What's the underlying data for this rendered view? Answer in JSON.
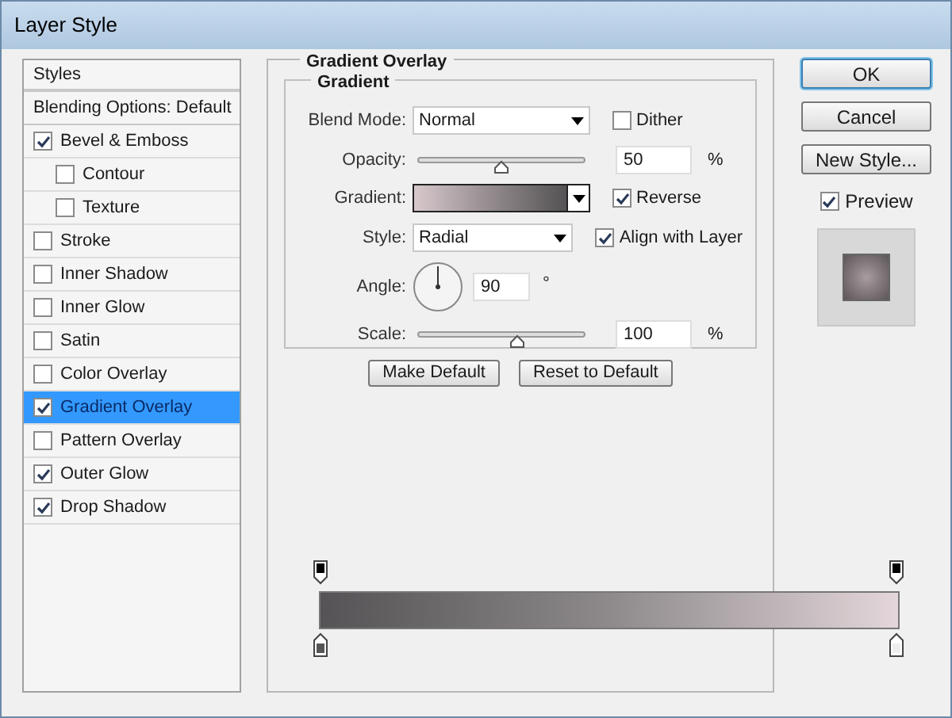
{
  "window": {
    "title": "Layer Style"
  },
  "sidebar": {
    "items": [
      {
        "label": "Styles",
        "kind": "header",
        "selected": false
      },
      {
        "label": "Blending Options: Default",
        "kind": "plain",
        "selected": false
      },
      {
        "label": "Bevel & Emboss",
        "kind": "check",
        "checked": true,
        "selected": false,
        "children": [
          {
            "label": "Contour",
            "kind": "check",
            "checked": false,
            "selected": false
          },
          {
            "label": "Texture",
            "kind": "check",
            "checked": false,
            "selected": false
          }
        ]
      },
      {
        "label": "Stroke",
        "kind": "check",
        "checked": false,
        "selected": false
      },
      {
        "label": "Inner Shadow",
        "kind": "check",
        "checked": false,
        "selected": false
      },
      {
        "label": "Inner Glow",
        "kind": "check",
        "checked": false,
        "selected": false
      },
      {
        "label": "Satin",
        "kind": "check",
        "checked": false,
        "selected": false
      },
      {
        "label": "Color Overlay",
        "kind": "check",
        "checked": false,
        "selected": false
      },
      {
        "label": "Gradient Overlay",
        "kind": "check",
        "checked": true,
        "selected": true
      },
      {
        "label": "Pattern Overlay",
        "kind": "check",
        "checked": false,
        "selected": false
      },
      {
        "label": "Outer Glow",
        "kind": "check",
        "checked": true,
        "selected": false
      },
      {
        "label": "Drop Shadow",
        "kind": "check",
        "checked": true,
        "selected": false
      }
    ]
  },
  "panel": {
    "title": "Gradient Overlay",
    "group_title": "Gradient",
    "blend_mode": {
      "label": "Blend Mode:",
      "value": "Normal"
    },
    "dither": {
      "label": "Dither",
      "checked": false
    },
    "opacity": {
      "label": "Opacity:",
      "level": 0.5,
      "value": "50",
      "unit": "%"
    },
    "gradient": {
      "label": "Gradient:"
    },
    "reverse": {
      "label": "Reverse",
      "checked": true
    },
    "style": {
      "label": "Style:",
      "value": "Radial"
    },
    "align": {
      "label": "Align with Layer",
      "checked": true
    },
    "angle": {
      "label": "Angle:",
      "value": "90",
      "unit": "°"
    },
    "scale": {
      "label": "Scale:",
      "level": 0.6,
      "value": "100",
      "unit": "%"
    },
    "buttons": [
      "Make Default",
      "Reset to Default"
    ]
  },
  "actions": {
    "buttons": [
      "OK",
      "Cancel",
      "New Style..."
    ],
    "preview": {
      "label": "Preview",
      "checked": true
    }
  }
}
